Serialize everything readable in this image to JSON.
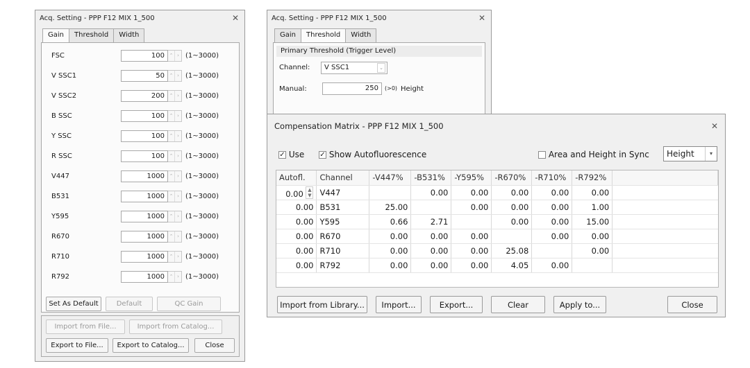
{
  "gain_window": {
    "title": "Acq. Setting - PPP F12 MIX 1_500",
    "tabs": [
      "Gain",
      "Threshold",
      "Width"
    ],
    "rows": [
      {
        "label": "FSC",
        "value": "100",
        "range": "(1~3000)"
      },
      {
        "label": "V SSC1",
        "value": "50",
        "range": "(1~3000)"
      },
      {
        "label": "V SSC2",
        "value": "200",
        "range": "(1~3000)"
      },
      {
        "label": "B SSC",
        "value": "100",
        "range": "(1~3000)"
      },
      {
        "label": "Y SSC",
        "value": "100",
        "range": "(1~3000)"
      },
      {
        "label": "R SSC",
        "value": "100",
        "range": "(1~3000)"
      },
      {
        "label": "V447",
        "value": "1000",
        "range": "(1~3000)"
      },
      {
        "label": "B531",
        "value": "1000",
        "range": "(1~3000)"
      },
      {
        "label": "Y595",
        "value": "1000",
        "range": "(1~3000)"
      },
      {
        "label": "R670",
        "value": "1000",
        "range": "(1~3000)"
      },
      {
        "label": "R710",
        "value": "1000",
        "range": "(1~3000)"
      },
      {
        "label": "R792",
        "value": "1000",
        "range": "(1~3000)"
      }
    ],
    "set_default": "Set As Default",
    "default": "Default",
    "qc_gain": "QC Gain",
    "import_file": "Import from File...",
    "import_catalog": "Import from Catalog...",
    "export_file": "Export to File...",
    "export_catalog": "Export to Catalog...",
    "close": "Close"
  },
  "threshold_window": {
    "title": "Acq. Setting - PPP F12 MIX 1_500",
    "tabs": [
      "Gain",
      "Threshold",
      "Width"
    ],
    "group_title": "Primary Threshold (Trigger Level)",
    "channel_label": "Channel:",
    "channel_value": "V SSC1",
    "manual_label": "Manual:",
    "manual_value": "250",
    "manual_hint": "(>0)",
    "manual_unit": "Height"
  },
  "comp_window": {
    "title": "Compensation Matrix - PPP F12 MIX 1_500",
    "use_label": "Use",
    "show_auto_label": "Show Autofluorescence",
    "sync_label": "Area and Height in Sync",
    "mode_value": "Height",
    "headers": [
      "Autofl.",
      "Channel",
      "-V447%",
      "-B531%",
      "-Y595%",
      "-R670%",
      "-R710%",
      "-R792%"
    ],
    "rows": [
      {
        "autofl": "0.00",
        "channel": "V447",
        "cells": [
          "",
          "0.00",
          "0.00",
          "0.00",
          "0.00",
          "0.00"
        ]
      },
      {
        "autofl": "0.00",
        "channel": "B531",
        "cells": [
          "25.00",
          "",
          "0.00",
          "0.00",
          "0.00",
          "1.00"
        ]
      },
      {
        "autofl": "0.00",
        "channel": "Y595",
        "cells": [
          "0.66",
          "2.71",
          "",
          "0.00",
          "0.00",
          "15.00"
        ]
      },
      {
        "autofl": "0.00",
        "channel": "R670",
        "cells": [
          "0.00",
          "0.00",
          "0.00",
          "",
          "0.00",
          "0.00"
        ]
      },
      {
        "autofl": "0.00",
        "channel": "R710",
        "cells": [
          "0.00",
          "0.00",
          "0.00",
          "25.08",
          "",
          "0.00"
        ]
      },
      {
        "autofl": "0.00",
        "channel": "R792",
        "cells": [
          "0.00",
          "0.00",
          "0.00",
          "4.05",
          "0.00",
          ""
        ]
      }
    ],
    "import_library": "Import from Library...",
    "import": "Import...",
    "export": "Export...",
    "clear": "Clear",
    "apply_to": "Apply to...",
    "close": "Close"
  }
}
